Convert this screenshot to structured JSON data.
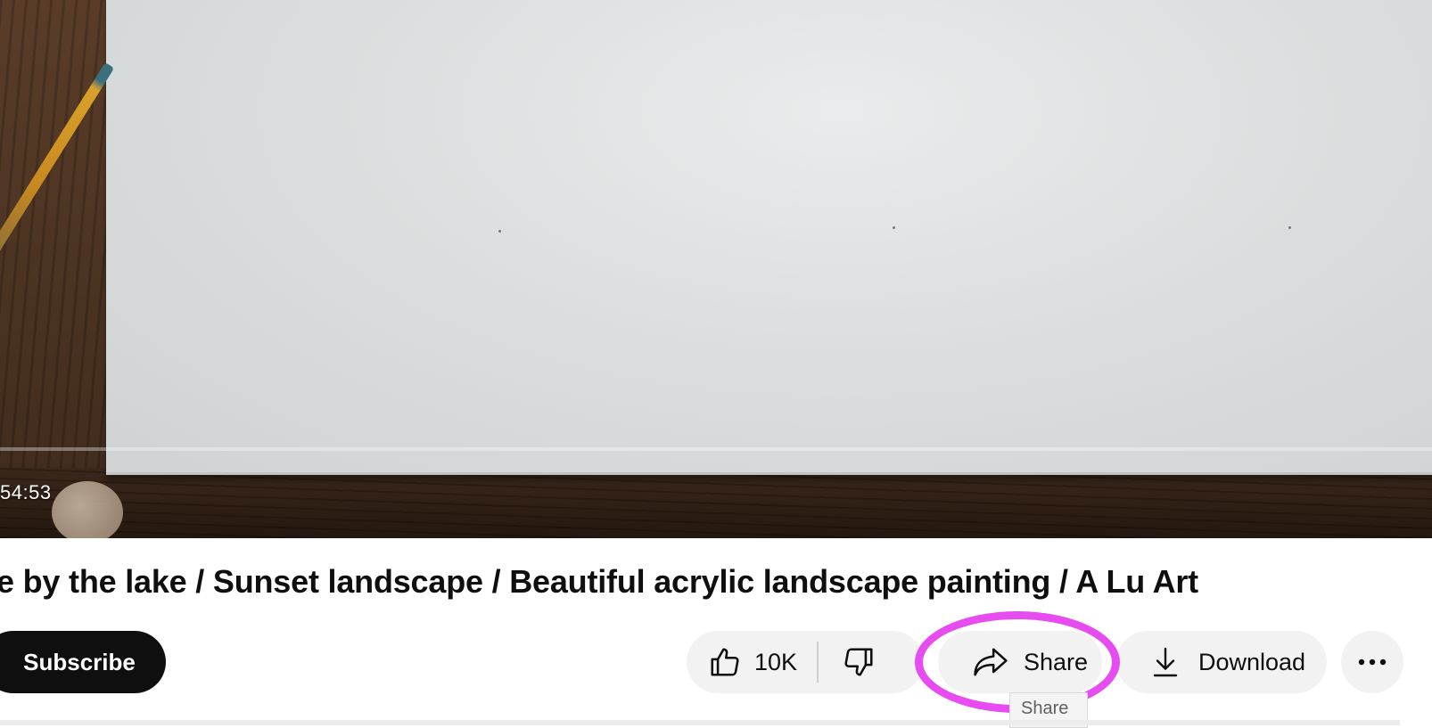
{
  "video": {
    "timestamp": "54:53"
  },
  "title": "e by the lake / Sunset landscape / Beautiful acrylic landscape painting / A Lu Art",
  "actions": {
    "subscribe_label": "Subscribe",
    "like_count": "10K",
    "share_label": "Share",
    "download_label": "Download",
    "tooltip": "Share"
  },
  "colors": {
    "highlight": "#e64cf0",
    "subscribe_bg": "#0f0f0f",
    "pill_bg": "#f2f2f2"
  },
  "icons": [
    "thumbs-up-icon",
    "thumbs-down-icon",
    "share-arrow-icon",
    "download-icon",
    "more-horizontal-icon"
  ]
}
